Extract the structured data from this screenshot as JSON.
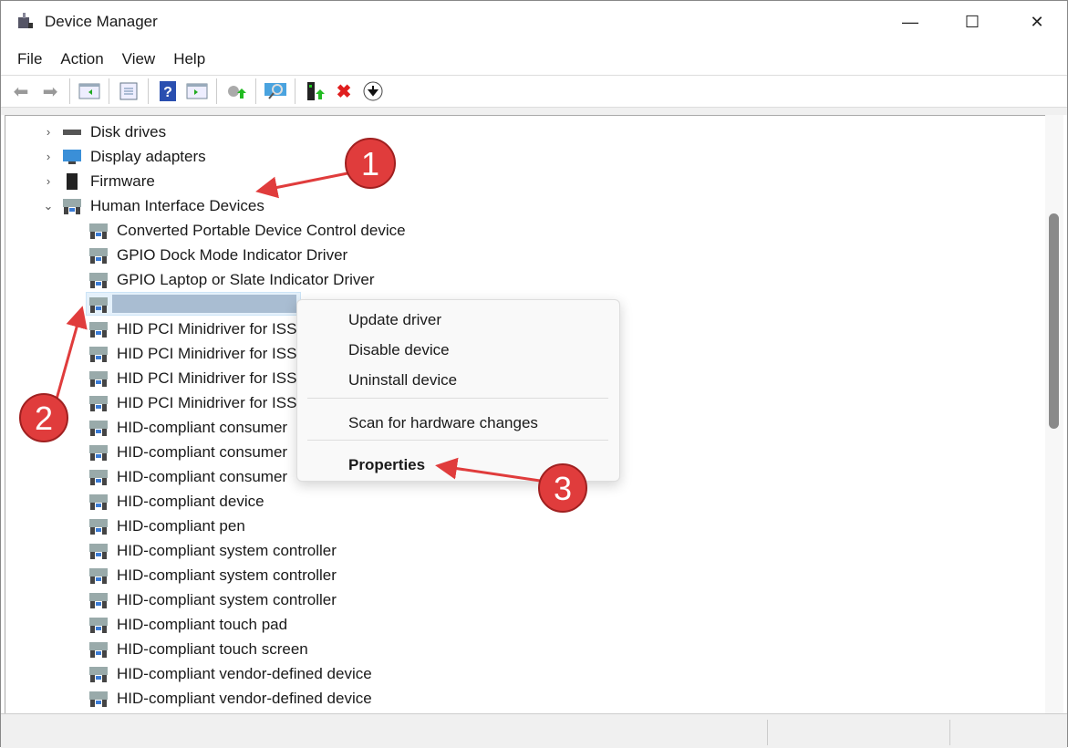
{
  "window": {
    "title": "Device Manager",
    "minimize": "—",
    "maximize": "☐",
    "close": "✕"
  },
  "menu": [
    "File",
    "Action",
    "View",
    "Help"
  ],
  "toolbar": [
    "back-icon",
    "forward-icon",
    "show-hide-console-tree-icon",
    "properties-icon",
    "help-icon",
    "show-action-pane-icon",
    "update-driver-icon",
    "scan-hardware-icon",
    "enable-device-icon",
    "uninstall-device-icon",
    "disable-device-icon"
  ],
  "tree": {
    "categories": [
      {
        "label": "Disk drives",
        "expanded": false
      },
      {
        "label": "Display adapters",
        "expanded": false
      },
      {
        "label": "Firmware",
        "expanded": false
      },
      {
        "label": "Human Interface Devices",
        "expanded": true
      }
    ],
    "children": [
      "Converted Portable Device Control device",
      "GPIO Dock Mode Indicator Driver",
      "GPIO Laptop or Slate Indicator Driver",
      "",
      "HID PCI Minidriver for ISS",
      "HID PCI Minidriver for ISS",
      "HID PCI Minidriver for ISS",
      "HID PCI Minidriver for ISS",
      "HID-compliant consumer",
      "HID-compliant consumer",
      "HID-compliant consumer",
      "HID-compliant device",
      "HID-compliant pen",
      "HID-compliant system controller",
      "HID-compliant system controller",
      "HID-compliant system controller",
      "HID-compliant touch pad",
      "HID-compliant touch screen",
      "HID-compliant vendor-defined device",
      "HID-compliant vendor-defined device"
    ]
  },
  "context_menu": {
    "update": "Update driver",
    "disable": "Disable device",
    "uninstall": "Uninstall device",
    "scan": "Scan for hardware changes",
    "properties": "Properties"
  },
  "annotations": [
    "1",
    "2",
    "3"
  ],
  "colors": {
    "annotation": "#e03c3c",
    "selection": "#e5f1fb"
  }
}
